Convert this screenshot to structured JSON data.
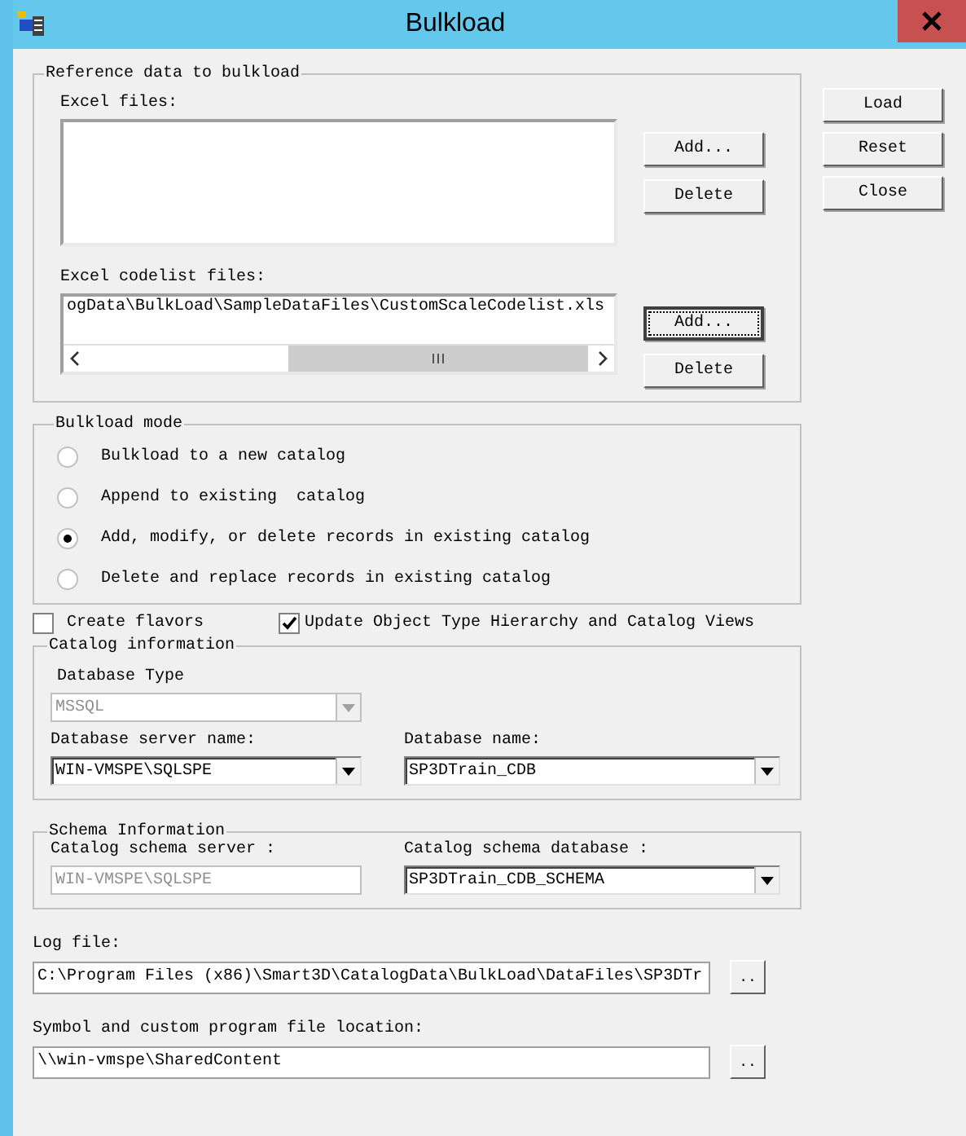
{
  "window": {
    "title": "Bulkload"
  },
  "actions": [
    {
      "label": "Load"
    },
    {
      "label": "Reset"
    },
    {
      "label": "Close"
    }
  ],
  "reference_data": {
    "title": "Reference data to bulkload",
    "excel_files": {
      "label": "Excel files:",
      "buttons": [
        {
          "label": "Add...",
          "focused": false
        },
        {
          "label": "Delete",
          "focused": false
        }
      ]
    },
    "codelist_files": {
      "label": "Excel codelist files:",
      "items": [
        "ogData\\BulkLoad\\SampleDataFiles\\CustomScaleCodelist.xls"
      ],
      "buttons": [
        {
          "label": "Add...",
          "focused": true
        },
        {
          "label": "Delete",
          "focused": false
        }
      ]
    }
  },
  "bulkload_mode": {
    "title": "Bulkload mode",
    "options": [
      {
        "label": "Bulkload to a new catalog",
        "selected": false
      },
      {
        "label": "Append to existing  catalog",
        "selected": false
      },
      {
        "label": "Add, modify, or delete records in existing catalog",
        "selected": true
      },
      {
        "label": "Delete and replace records in existing catalog",
        "selected": false
      }
    ]
  },
  "flags": [
    {
      "label": "Create flavors",
      "checked": false
    },
    {
      "label": "Update Object Type Hierarchy and Catalog Views",
      "checked": true
    }
  ],
  "catalog_information": {
    "title": "Catalog information",
    "fields": [
      {
        "label": "Database Type",
        "value": "MSSQL",
        "kind": "dropdown",
        "disabled": true
      },
      {
        "label": "Database server name:",
        "value": "WIN-VMSPE\\SQLSPE",
        "kind": "dropdown",
        "disabled": false
      },
      {
        "label": "Database name:",
        "value": "SP3DTrain_CDB",
        "kind": "dropdown",
        "disabled": false
      }
    ]
  },
  "schema_information": {
    "title": "Schema Information",
    "fields": [
      {
        "label": "Catalog schema server :",
        "value": "WIN-VMSPE\\SQLSPE",
        "kind": "text",
        "disabled": true
      },
      {
        "label": "Catalog schema database :",
        "value": "SP3DTrain_CDB_SCHEMA",
        "kind": "dropdown",
        "disabled": false
      }
    ]
  },
  "paths": [
    {
      "label": "Log file:",
      "value": "C:\\Program Files (x86)\\Smart3D\\CatalogData\\BulkLoad\\DataFiles\\SP3DTr",
      "browse": ".."
    },
    {
      "label": "Symbol and custom program file location:",
      "value": "\\\\win-vmspe\\SharedContent",
      "browse": ".."
    }
  ]
}
